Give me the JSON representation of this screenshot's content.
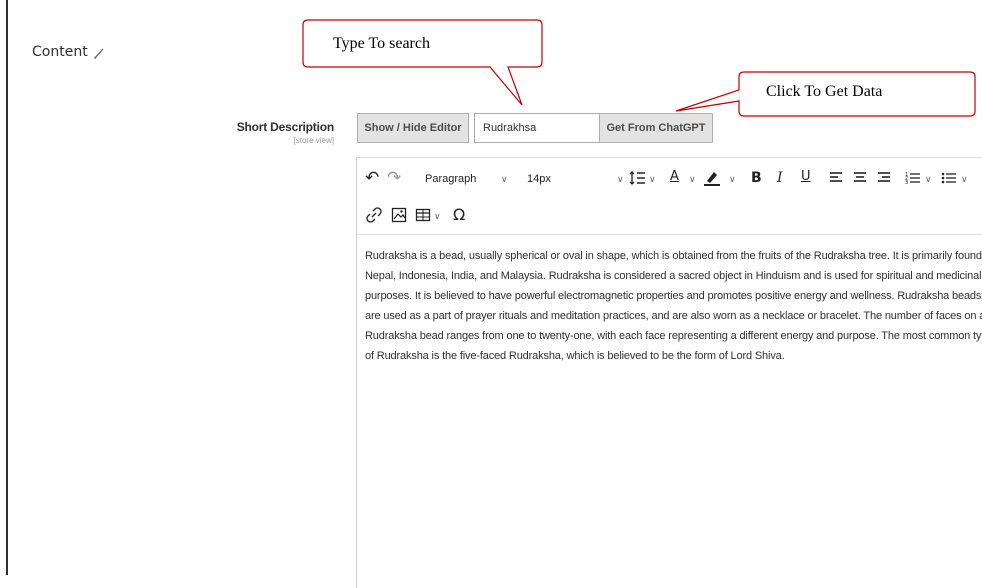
{
  "section": {
    "title": "Content",
    "edit_icon": "pencil-icon"
  },
  "field": {
    "label": "Short Description",
    "scope": "[store view]"
  },
  "actions": {
    "toggle_editor_label": "Show / Hide Editor",
    "search_value": "Rudrakhsa",
    "fetch_label": "Get From ChatGPT"
  },
  "toolbar": {
    "undo_icon": "undo-icon",
    "redo_icon": "redo-icon",
    "block_format": "Paragraph",
    "font_size": "14px",
    "line_height_icon": "line-height-icon",
    "text_color_icon": "text-color-icon",
    "highlight_icon": "highlight-icon",
    "bold": "B",
    "italic": "I",
    "underline": "U",
    "align_left_icon": "align-left-icon",
    "align_center_icon": "align-center-icon",
    "align_right_icon": "align-right-icon",
    "numbered_list_icon": "numbered-list-icon",
    "bullet_list_icon": "bullet-list-icon",
    "link_icon": "link-icon",
    "image_icon": "image-icon",
    "table_icon": "table-icon",
    "special_char": "Ω"
  },
  "editor": {
    "body": "Rudraksha is a bead, usually spherical or oval in shape, which is obtained from the fruits of the Rudraksha tree. It is primarily found in Nepal, Indonesia, India, and Malaysia. Rudraksha is considered a sacred object in Hinduism and is used for spiritual and medicinal purposes. It is believed to have powerful electromagnetic properties and promotes positive energy and wellness. Rudraksha beads are used as a part of prayer rituals and meditation practices, and are also worn as a necklace or bracelet. The number of faces on a Rudraksha bead ranges from one to twenty-one, with each face representing a different energy and purpose. The most common type of Rudraksha is the five-faced Rudraksha, which is believed to be the form of Lord Shiva."
  },
  "callouts": {
    "search_hint": "Type To search",
    "fetch_hint": "Click To Get Data"
  },
  "colors": {
    "button_bg": "#e3e3e3",
    "callout_stroke": "#c00000"
  }
}
